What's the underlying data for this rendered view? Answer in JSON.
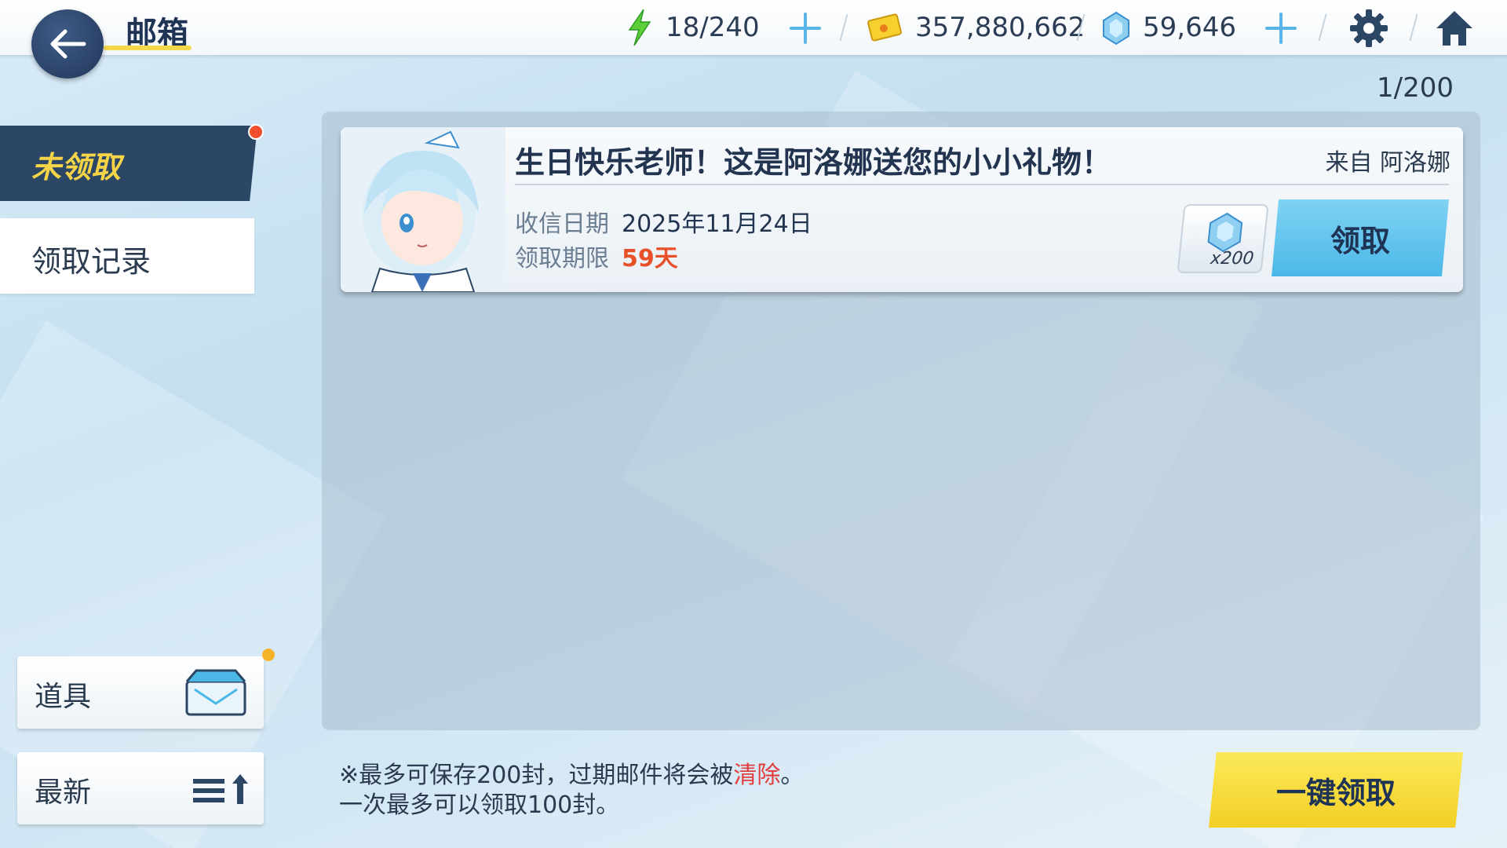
{
  "header": {
    "title": "邮箱",
    "energy": "18/240",
    "credits": "357,880,662",
    "gems": "59,646"
  },
  "page_counter": "1/200",
  "tabs": {
    "unclaimed": "未领取",
    "history": "领取记录"
  },
  "filters": {
    "category": "道具",
    "sort": "最新"
  },
  "mail": {
    "title": "生日快乐老师！这是阿洛娜送您的小小礼物！",
    "from": "来自 阿洛娜",
    "received_label": "收信日期",
    "received_date": "2025年11月24日",
    "deadline_label": "领取期限",
    "deadline_value": "59天",
    "reward_qty": "x200",
    "claim_label": "领取"
  },
  "footer": {
    "note1_prefix": "※最多可保存200封，过期邮件将会被",
    "note1_highlight": "清除",
    "note1_suffix": "。",
    "note2": "一次最多可以领取100封。",
    "claim_all_label": "一键领取"
  },
  "colors": {
    "accent_yellow": "#f5d547",
    "navy": "#2c4766",
    "claim_blue": "#4cb8e8",
    "alert_red": "#e8502a"
  },
  "icons": [
    "back-arrow-icon",
    "lightning-icon",
    "credit-card-icon",
    "gem-icon",
    "gear-icon",
    "home-icon",
    "mailbox-icon",
    "sort-icon"
  ]
}
